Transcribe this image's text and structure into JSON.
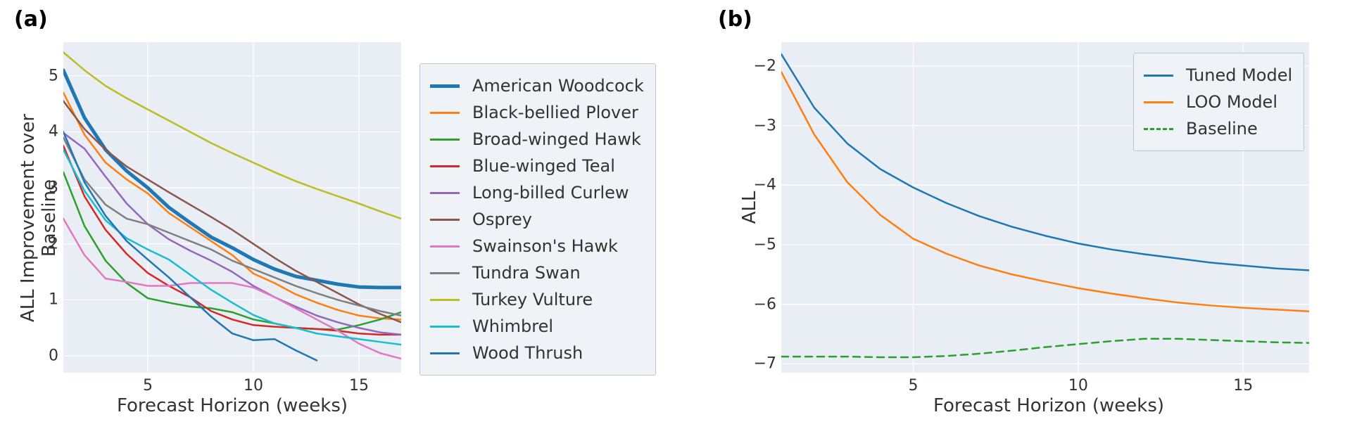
{
  "chart_data": [
    {
      "type": "line",
      "panel_label": "(a)",
      "xlabel": "Forecast Horizon (weeks)",
      "ylabel": "ALL Improvement over Baseline",
      "x": [
        1,
        2,
        3,
        4,
        5,
        6,
        7,
        8,
        9,
        10,
        11,
        12,
        13,
        14,
        15,
        16,
        17
      ],
      "xlim": [
        1,
        17
      ],
      "ylim": [
        -0.3,
        5.6
      ],
      "xticks": [
        5,
        10,
        15
      ],
      "yticks": [
        0,
        1,
        2,
        3,
        4,
        5
      ],
      "series": [
        {
          "name": "American Woodcock",
          "color": "#1f77b4",
          "thick": true,
          "values": [
            5.1,
            4.25,
            3.68,
            3.3,
            3.0,
            2.65,
            2.38,
            2.12,
            1.93,
            1.72,
            1.55,
            1.42,
            1.35,
            1.28,
            1.23,
            1.22,
            1.22
          ]
        },
        {
          "name": "Black-bellied Plover",
          "color": "#ff7f0e",
          "values": [
            4.7,
            3.95,
            3.45,
            3.15,
            2.9,
            2.55,
            2.3,
            2.05,
            1.8,
            1.47,
            1.3,
            1.1,
            0.95,
            0.82,
            0.72,
            0.67,
            0.65
          ]
        },
        {
          "name": "Broad-winged Hawk",
          "color": "#2ca02c",
          "values": [
            3.28,
            2.32,
            1.7,
            1.3,
            1.03,
            0.95,
            0.88,
            0.85,
            0.78,
            0.65,
            0.58,
            0.5,
            0.48,
            0.47,
            0.55,
            0.65,
            0.78
          ]
        },
        {
          "name": "Blue-winged Teal",
          "color": "#d62728",
          "values": [
            3.75,
            2.85,
            2.25,
            1.82,
            1.48,
            1.25,
            1.05,
            0.8,
            0.65,
            0.55,
            0.52,
            0.5,
            0.48,
            0.45,
            0.4,
            0.38,
            0.38
          ]
        },
        {
          "name": "Long-billed Curlew",
          "color": "#9467bd",
          "values": [
            3.98,
            3.7,
            3.2,
            2.72,
            2.35,
            2.08,
            1.88,
            1.7,
            1.5,
            1.25,
            1.05,
            0.88,
            0.72,
            0.6,
            0.5,
            0.42,
            0.38
          ]
        },
        {
          "name": "Osprey",
          "color": "#8c564b",
          "values": [
            4.55,
            4.05,
            3.68,
            3.38,
            3.15,
            2.92,
            2.7,
            2.48,
            2.25,
            2.0,
            1.75,
            1.52,
            1.32,
            1.12,
            0.92,
            0.75,
            0.6
          ]
        },
        {
          "name": "Swainson's Hawk",
          "color": "#e377c2",
          "values": [
            2.45,
            1.8,
            1.38,
            1.32,
            1.25,
            1.25,
            1.3,
            1.3,
            1.3,
            1.22,
            1.05,
            0.85,
            0.65,
            0.45,
            0.22,
            0.05,
            -0.05
          ]
        },
        {
          "name": "Tundra Swan",
          "color": "#7f7f7f",
          "values": [
            3.9,
            3.15,
            2.7,
            2.45,
            2.35,
            2.2,
            2.05,
            1.9,
            1.7,
            1.55,
            1.4,
            1.25,
            1.12,
            1.0,
            0.9,
            0.8,
            0.72
          ]
        },
        {
          "name": "Turkey Vulture",
          "color": "#bcbd22",
          "values": [
            5.42,
            5.1,
            4.82,
            4.6,
            4.4,
            4.2,
            4.0,
            3.8,
            3.62,
            3.45,
            3.28,
            3.12,
            2.98,
            2.85,
            2.72,
            2.58,
            2.45
          ]
        },
        {
          "name": "Whimbrel",
          "color": "#17becf",
          "values": [
            3.68,
            2.95,
            2.42,
            2.1,
            1.9,
            1.72,
            1.45,
            1.18,
            0.95,
            0.73,
            0.58,
            0.5,
            0.4,
            0.35,
            0.3,
            0.25,
            0.2
          ]
        },
        {
          "name": "Wood Thrush",
          "color": "#1f77b4",
          "values": [
            4.0,
            3.1,
            2.5,
            2.05,
            1.72,
            1.4,
            1.05,
            0.7,
            0.4,
            0.28,
            0.3,
            0.1,
            -0.08,
            null,
            null,
            null,
            null
          ]
        }
      ]
    },
    {
      "type": "line",
      "panel_label": "(b)",
      "xlabel": "Forecast Horizon (weeks)",
      "ylabel": "ALL",
      "x": [
        1,
        2,
        3,
        4,
        5,
        6,
        7,
        8,
        9,
        10,
        11,
        12,
        13,
        14,
        15,
        16,
        17
      ],
      "xlim": [
        1,
        17
      ],
      "ylim": [
        -7.15,
        -1.6
      ],
      "xticks": [
        5,
        10,
        15
      ],
      "yticks": [
        -7,
        -6,
        -5,
        -4,
        -3,
        -2
      ],
      "series": [
        {
          "name": "Tuned Model",
          "color": "#1f77b4",
          "values": [
            -1.8,
            -2.7,
            -3.3,
            -3.73,
            -4.04,
            -4.3,
            -4.52,
            -4.7,
            -4.85,
            -4.98,
            -5.08,
            -5.16,
            -5.23,
            -5.3,
            -5.35,
            -5.4,
            -5.43
          ]
        },
        {
          "name": "LOO Model",
          "color": "#ff7f0e",
          "values": [
            -2.1,
            -3.15,
            -3.95,
            -4.5,
            -4.9,
            -5.15,
            -5.35,
            -5.5,
            -5.62,
            -5.73,
            -5.82,
            -5.9,
            -5.97,
            -6.02,
            -6.06,
            -6.09,
            -6.12
          ]
        },
        {
          "name": "Baseline",
          "color": "#2ca02c",
          "dashed": true,
          "values": [
            -6.88,
            -6.88,
            -6.88,
            -6.89,
            -6.89,
            -6.87,
            -6.83,
            -6.78,
            -6.72,
            -6.67,
            -6.62,
            -6.58,
            -6.58,
            -6.6,
            -6.62,
            -6.64,
            -6.65
          ]
        }
      ]
    }
  ]
}
